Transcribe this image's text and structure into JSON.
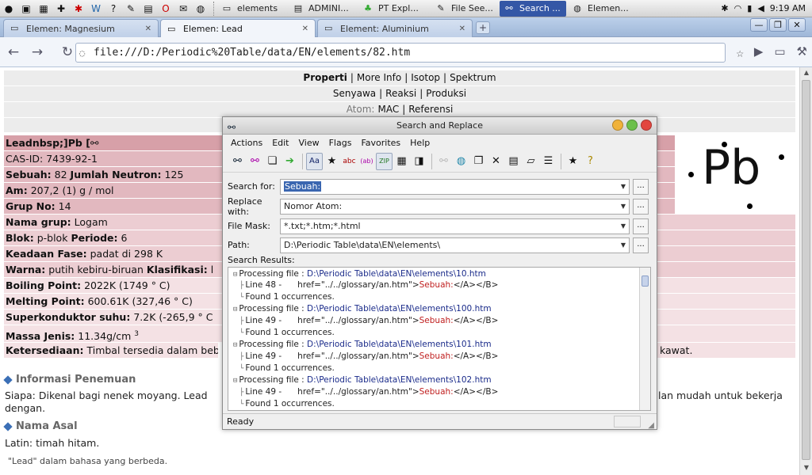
{
  "taskbar": {
    "launchers": [
      "apple-icon",
      "window-icon",
      "image-icon",
      "puzzle-icon",
      "asterisk-icon",
      "w-icon",
      "help-icon",
      "pencil-icon",
      "book-icon",
      "opera-icon",
      "mail-icon",
      "globe-icon"
    ],
    "tasks": [
      {
        "label": "elements",
        "icon": "folder-icon"
      },
      {
        "label": "ADMINI...",
        "icon": "doc-icon"
      },
      {
        "label": "PT Expl...",
        "icon": "plant-icon"
      },
      {
        "label": "File See...",
        "icon": "edit-icon"
      },
      {
        "label": "Search ...",
        "icon": "binoculars-icon"
      },
      {
        "label": "Elemen...",
        "icon": "browser-icon"
      }
    ],
    "clock": "9:19 AM"
  },
  "browser": {
    "tabs": [
      {
        "label": "Elemen: Magnesium"
      },
      {
        "label": "Elemen: Lead"
      },
      {
        "label": "Element: Aluminium"
      }
    ],
    "url": "file:///D:/Periodic%20Table/data/EN/elements/82.htm"
  },
  "page": {
    "nav1": {
      "item1": "Properti",
      "item2": "More Info",
      "item3": "Isotop",
      "item4": "Spektrum"
    },
    "nav2": {
      "item1": "Senyawa",
      "item2": "Reaksi",
      "item3": "Produksi"
    },
    "nav3": {
      "item1": "Atom:",
      "item2": "MAC",
      "item3": "Referensi"
    },
    "symbol": "Pb",
    "props": {
      "name": "Leadnbsp;]Pb [",
      "casid": "CAS-ID: 7439-92-1",
      "sebuah_label": "Sebuah:",
      "sebuah_val": "82",
      "neutron_label": "Jumlah Neutron:",
      "neutron_val": "125",
      "am_label": "Am:",
      "am_val": "207,2 (1) g / mol",
      "grup_label": "Grup No:",
      "grup_val": "14",
      "nama_label": "Nama grup:",
      "nama_val": "Logam",
      "blok_label": "Blok:",
      "blok_val": "p-blok",
      "periode_label": "Periode:",
      "periode_val": "6",
      "fase_label": "Keadaan Fase:",
      "fase_val": "padat di 298 K",
      "warna_label": "Warna:",
      "warna_val": "putih kebiru-biruan",
      "klas_label": "Klasifikasi:",
      "klas_val": "l",
      "boil_label": "Boiling Point:",
      "boil_val": "2022K (1749 ° C)",
      "melt_label": "Melting Point:",
      "melt_val": "600.61K (327,46 ° C)",
      "super_label": "Superkonduktor suhu:",
      "super_val": "7.2K (-265,9 ° C",
      "massa_label": "Massa Jenis:",
      "massa_val": "11.34g/cm",
      "massa_sup": "3",
      "keter_label": "Ketersediaan:",
      "keter_val": "Timbal tersedia dalam beb",
      "keter_tail": "kawat."
    },
    "sections": {
      "info_title": "Informasi Penemuan",
      "siapa": "Siapa: Dikenal bagi nenek moyang. Lead",
      "siapa_tail": "lan mudah untuk bekerja",
      "dengan": "dengan.",
      "nama_title": "Nama Asal",
      "latin": "Latin: timah hitam.",
      "lead_note": "\"Lead\" dalam bahasa yang berbeda."
    }
  },
  "dialog": {
    "title": "Search and Replace",
    "menu": [
      "Actions",
      "Edit",
      "View",
      "Flags",
      "Favorites",
      "Help"
    ],
    "fields": {
      "search_label": "Search for:",
      "search_value": "Sebuah:",
      "replace_label": "Replace with:",
      "replace_value": "Nomor Atom:",
      "mask_label": "File Mask:",
      "mask_value": "*.txt;*.htm;*.html",
      "path_label": "Path:",
      "path_value": "D:\\Periodic Table\\data\\EN\\elements\\",
      "browse": "..."
    },
    "results_label": "Search Results:",
    "results": [
      {
        "file": "D:\\Periodic Table\\data\\EN\\elements\\10.htm",
        "line": "Line  48 -",
        "code": "href=\"../../glossary/an.htm\">",
        "match": "Sebuah:",
        "after": "</A></B>",
        "found": "Found 1 occurrences."
      },
      {
        "file": "D:\\Periodic Table\\data\\EN\\elements\\100.htm",
        "line": "Line  49 -",
        "code": "href=\"../../glossary/an.htm\">",
        "match": "Sebuah:",
        "after": "</A></B>",
        "found": "Found 1 occurrences."
      },
      {
        "file": "D:\\Periodic Table\\data\\EN\\elements\\101.htm",
        "line": "Line  49 -",
        "code": "href=\"../../glossary/an.htm\">",
        "match": "Sebuah:",
        "after": "</A></B>",
        "found": "Found 1 occurrences."
      },
      {
        "file": "D:\\Periodic Table\\data\\EN\\elements\\102.htm",
        "line": "Line  49 -",
        "code": "href=\"../../glossary/an.htm\">",
        "match": "Sebuah:",
        "after": "</A></B>",
        "found": "Found 1 occurrences."
      }
    ],
    "processing": "Processing file :",
    "status": "Ready"
  },
  "colors": {
    "accent": "#3457a6",
    "row_dark": "#d7a0a8",
    "row_pale": "#f4e1e4",
    "match_red": "#c02020"
  }
}
